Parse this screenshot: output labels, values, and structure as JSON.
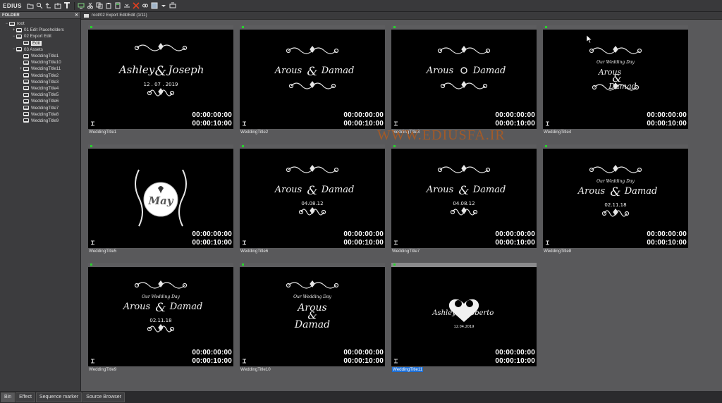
{
  "app": {
    "brand": "EDIUS"
  },
  "toolbar": {
    "icons": [
      "folder-icon",
      "search-icon",
      "undo-icon",
      "open-icon",
      "title-icon",
      "capture-icon",
      "cut-icon",
      "copy-icon",
      "paste-icon",
      "add-icon",
      "delete-icon",
      "link-icon",
      "view-icon",
      "dropdown-icon",
      "tape-icon"
    ]
  },
  "folder_panel": {
    "title": "FOLDER",
    "close": "✕",
    "tree": [
      {
        "label": "root",
        "depth": 0,
        "expander": "−"
      },
      {
        "label": "01 Edit Placeholders",
        "depth": 1,
        "expander": "+"
      },
      {
        "label": "02 Export Edit",
        "depth": 1,
        "expander": "−"
      },
      {
        "label": "Edit",
        "depth": 2,
        "expander": "",
        "selected": true
      },
      {
        "label": "03 Assets",
        "depth": 1,
        "expander": "−"
      },
      {
        "label": "WeddingTitle1",
        "depth": 2,
        "expander": ""
      },
      {
        "label": "WeddingTitle10",
        "depth": 2,
        "expander": ""
      },
      {
        "label": "WeddingTitle11",
        "depth": 2,
        "expander": "+"
      },
      {
        "label": "WeddingTitle2",
        "depth": 2,
        "expander": ""
      },
      {
        "label": "WeddingTitle3",
        "depth": 2,
        "expander": ""
      },
      {
        "label": "WeddingTitle4",
        "depth": 2,
        "expander": ""
      },
      {
        "label": "WeddingTitle5",
        "depth": 2,
        "expander": ""
      },
      {
        "label": "WeddingTitle6",
        "depth": 2,
        "expander": ""
      },
      {
        "label": "WeddingTitle7",
        "depth": 2,
        "expander": ""
      },
      {
        "label": "WeddingTitle8",
        "depth": 2,
        "expander": ""
      },
      {
        "label": "WeddingTitle9",
        "depth": 2,
        "expander": ""
      }
    ]
  },
  "bin": {
    "path": "root/02 Export Edit/Edit (1/11)",
    "clips": [
      {
        "name": "WeddingTitle1",
        "tc_in": "00:00:00:00",
        "tc_dur": "00:00:10:00",
        "line1": "Ashley",
        "amp": "&",
        "line2": "Joseph",
        "date": "12 . 07 . 2019",
        "tagline": ""
      },
      {
        "name": "WeddingTitle2",
        "tc_in": "00:00:00:00",
        "tc_dur": "00:00:10:00",
        "line1": "Arous",
        "amp": "&",
        "line2": "Damad",
        "date": "",
        "tagline": ""
      },
      {
        "name": "WeddingTitle3",
        "tc_in": "00:00:00:00",
        "tc_dur": "00:00:10:00",
        "line1": "Arous",
        "amp": "",
        "line2": "Damad",
        "date": "",
        "tagline": ""
      },
      {
        "name": "WeddingTitle4",
        "tc_in": "00:00:00:00",
        "tc_dur": "00:00:10:00",
        "line1": "Arous",
        "amp": "&",
        "line2": "Damad",
        "date": "",
        "tagline": "Our Wedding Day"
      },
      {
        "name": "WeddingTitle5",
        "tc_in": "00:00:00:00",
        "tc_dur": "00:00:10:00",
        "line1": "May",
        "amp": "",
        "line2": "",
        "date": "",
        "tagline": ""
      },
      {
        "name": "WeddingTitle6",
        "tc_in": "00:00:00:00",
        "tc_dur": "00:00:10:00",
        "line1": "Arous",
        "amp": "&",
        "line2": "Damad",
        "date": "04.08.12",
        "tagline": ""
      },
      {
        "name": "WeddingTitle7",
        "tc_in": "00:00:00:00",
        "tc_dur": "00:00:10:00",
        "line1": "Arous",
        "amp": "&",
        "line2": "Damad",
        "date": "04.08.12",
        "tagline": ""
      },
      {
        "name": "WeddingTitle8",
        "tc_in": "00:00:00:00",
        "tc_dur": "00:00:10:00",
        "line1": "Arous",
        "amp": "&",
        "line2": "Damad",
        "date": "02.11.18",
        "tagline": "Our Wedding Day"
      },
      {
        "name": "WeddingTitle9",
        "tc_in": "00:00:00:00",
        "tc_dur": "00:00:10:00",
        "line1": "Arous",
        "amp": "&",
        "line2": "Damad",
        "date": "02.11.18",
        "tagline": "Our Wedding Day"
      },
      {
        "name": "WeddingTitle10",
        "tc_in": "00:00:00:00",
        "tc_dur": "00:00:10:00",
        "line1": "Arous",
        "amp": "&",
        "line2": "Damad",
        "date": "",
        "tagline": "Our Wedding Day"
      },
      {
        "name": "WeddingTitle11",
        "tc_in": "00:00:00:00",
        "tc_dur": "00:00:10:00",
        "line1": "Ashley",
        "amp": "&",
        "line2": "Roberto",
        "date": "12.04.2019",
        "tagline": "",
        "selected": true
      }
    ]
  },
  "watermark": "WWW.EDIUSFA.IR",
  "bottom_tabs": [
    "Bin",
    "Effect",
    "Sequence marker",
    "Source Browser"
  ],
  "colors": {
    "online_dot": "#27d52b",
    "selection": "#1d6fd6",
    "watermark": "#a35a28"
  }
}
